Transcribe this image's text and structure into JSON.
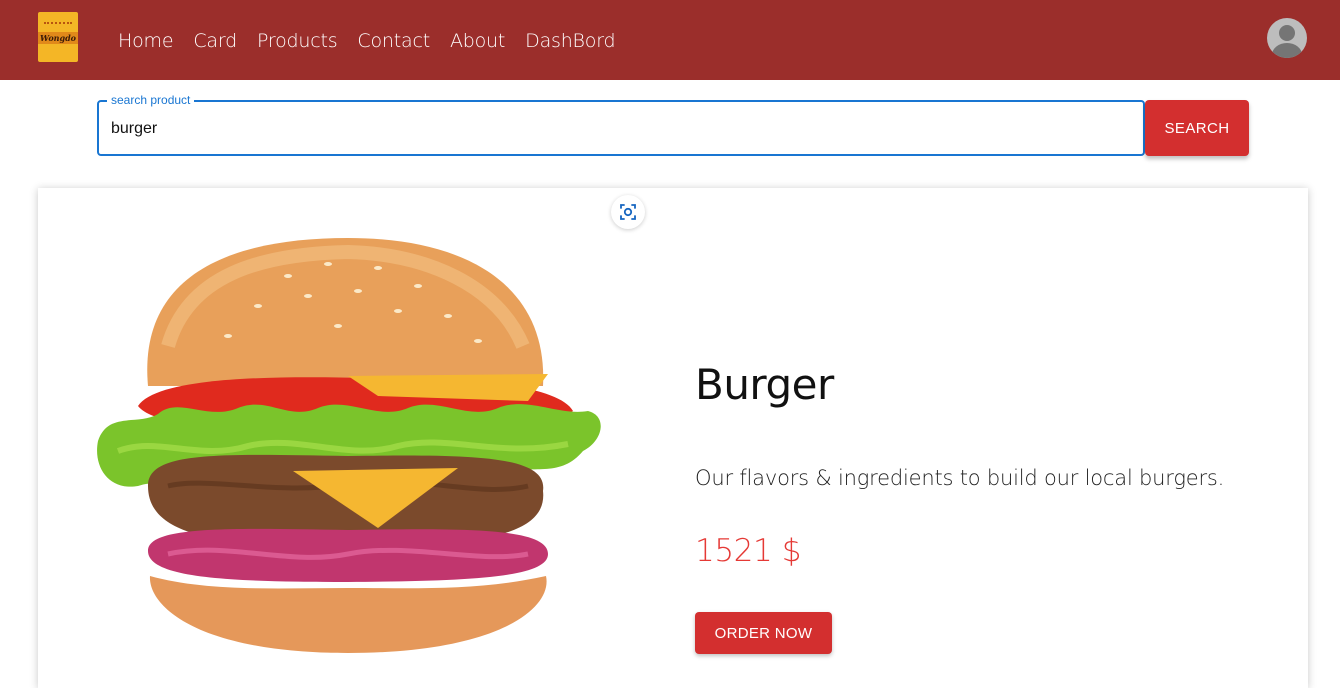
{
  "brand": {
    "logo_text": "Wongdo"
  },
  "nav": {
    "links": [
      "Home",
      "Card",
      "Products",
      "Contact",
      "About",
      "DashBord"
    ]
  },
  "search": {
    "label": "search product",
    "value": "burger",
    "button_label": "SEARCH"
  },
  "product": {
    "name": "Burger",
    "description": "Our flavors & ingredients to build our local burgers.",
    "price": "1521 $",
    "order_button_label": "ORDER NOW"
  },
  "colors": {
    "navbar": "#9b2e2b",
    "accent_red": "#d32f2f",
    "price_red": "#e53935",
    "focus_blue": "#1976d2"
  },
  "icons": {
    "avatar": "user-avatar-icon",
    "image_search": "lens-scan-icon"
  }
}
